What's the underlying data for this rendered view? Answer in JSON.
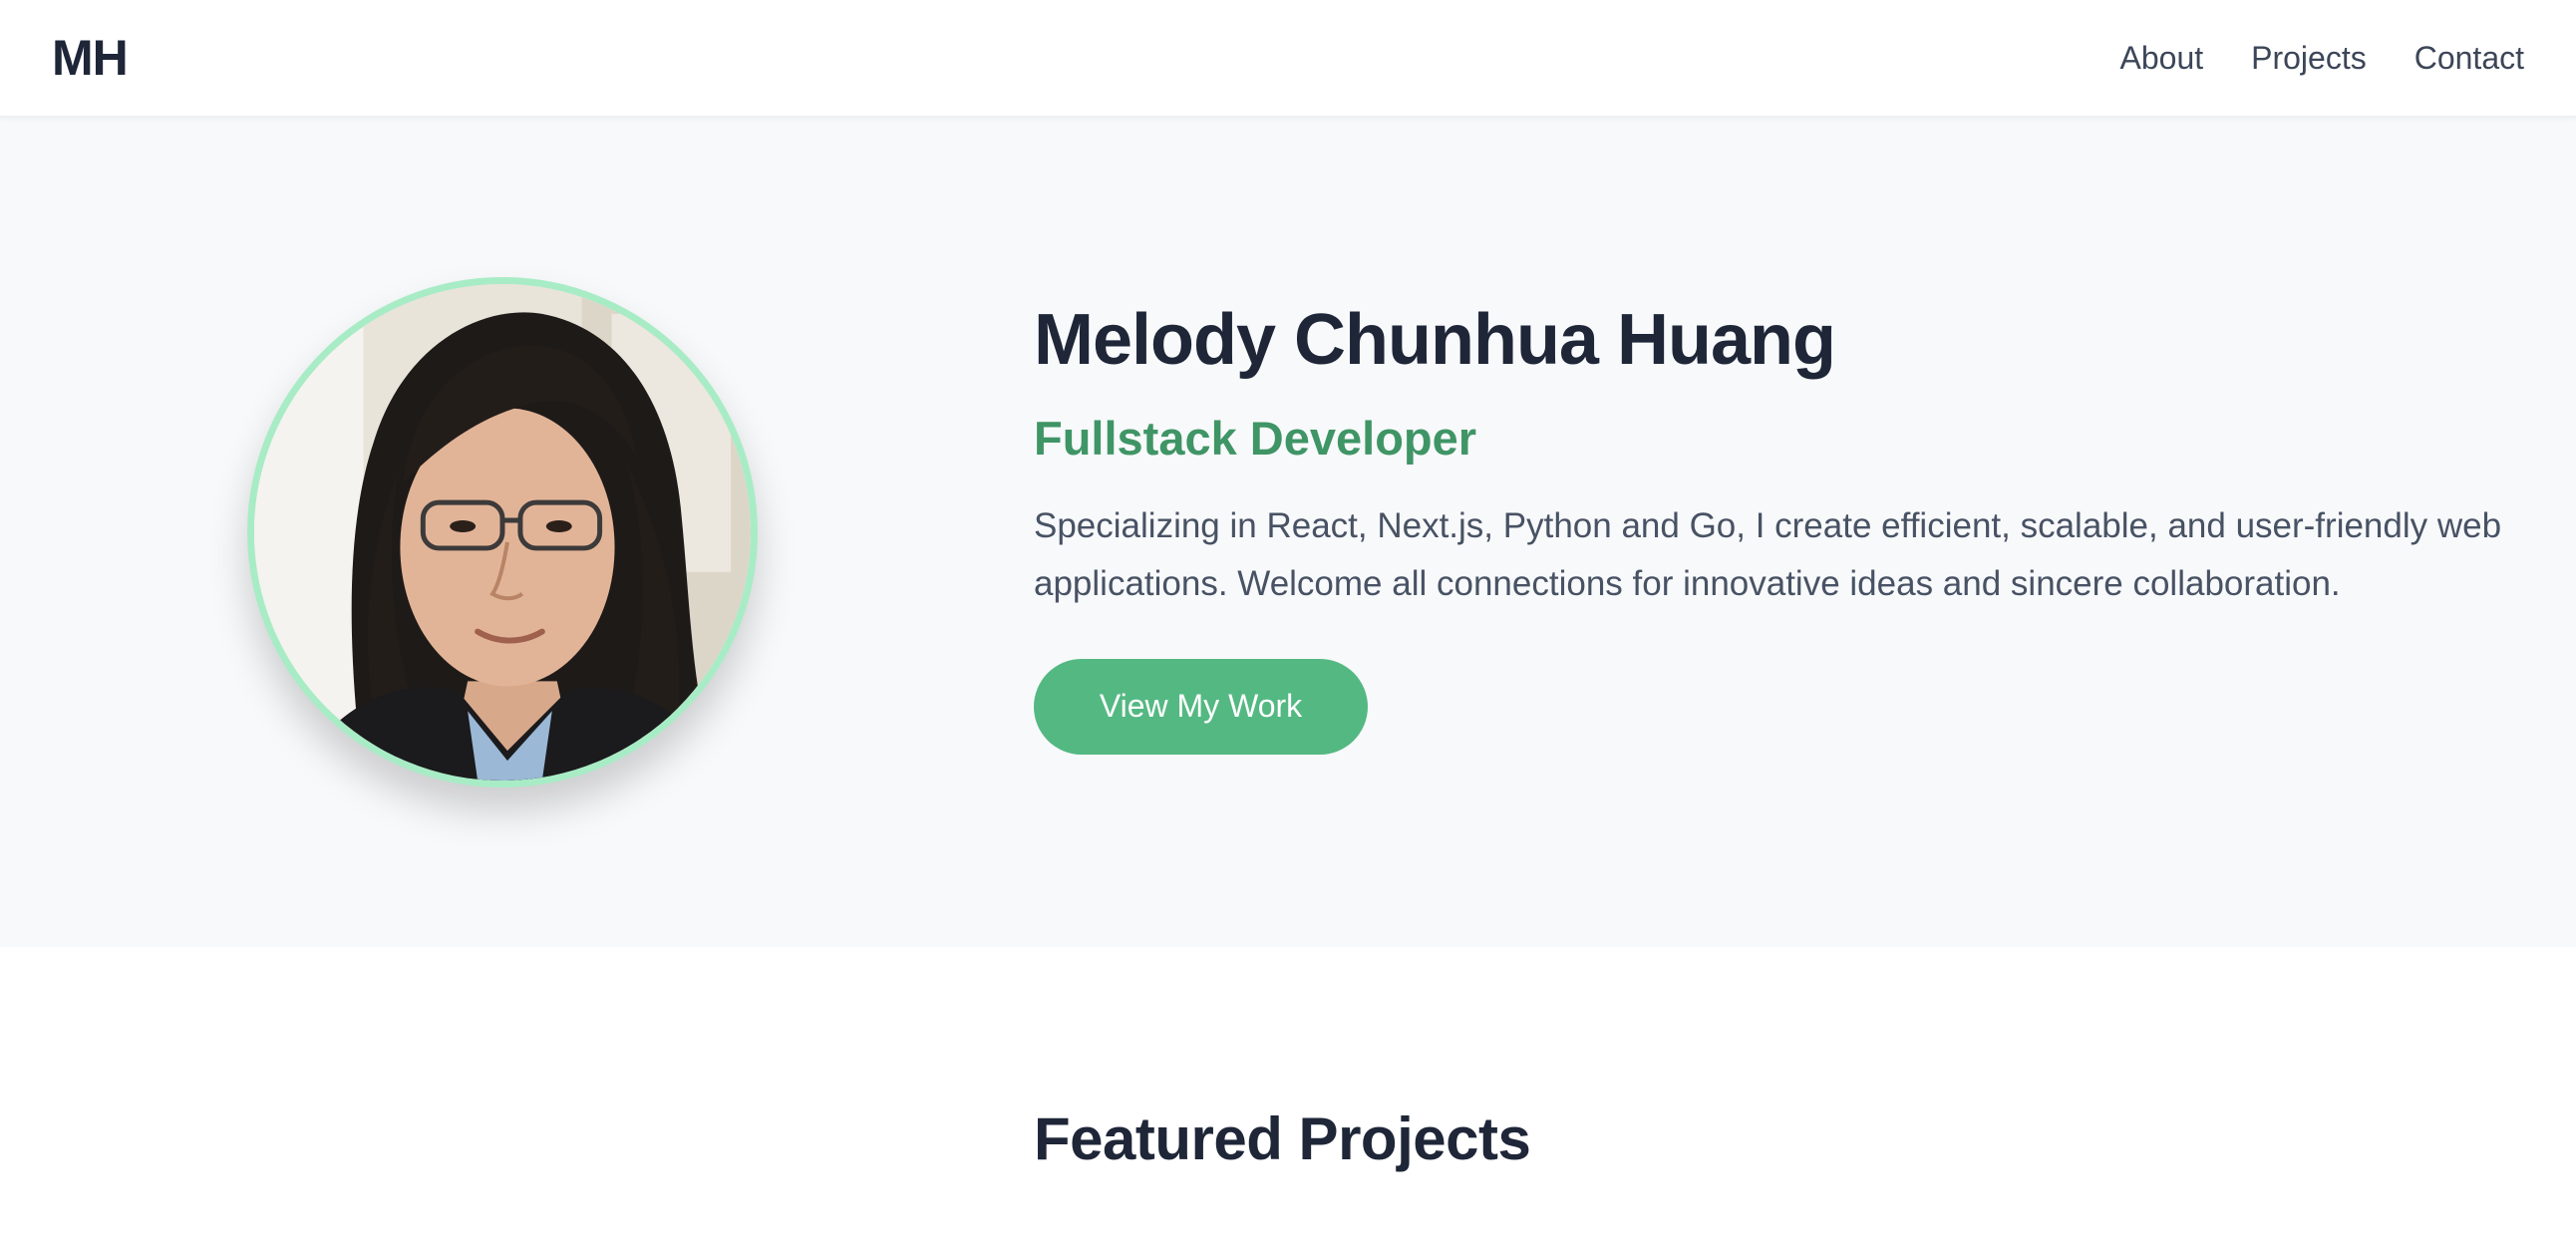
{
  "header": {
    "logo": "MH",
    "nav": [
      {
        "label": "About"
      },
      {
        "label": "Projects"
      },
      {
        "label": "Contact"
      }
    ]
  },
  "hero": {
    "name": "Melody Chunhua Huang",
    "role": "Fullstack Developer",
    "description": "Specializing in React, Next.js, Python and Go, I create efficient, scalable, and user-friendly web applications. Welcome all connections for innovative ideas and sincere collaboration.",
    "cta_label": "View My Work"
  },
  "featured": {
    "title": "Featured Projects"
  },
  "colors": {
    "accent": "#54b882",
    "accent_text": "#3f9565",
    "avatar_ring": "#a8ecc6",
    "heading": "#1e2638",
    "hero_bg": "#f8f9fb"
  }
}
